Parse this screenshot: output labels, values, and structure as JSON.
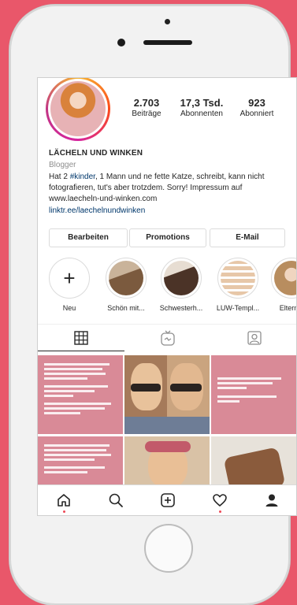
{
  "profile": {
    "name": "LÄCHELN UND WINKEN",
    "category": "Blogger",
    "bio_prefix": "Hat 2 ",
    "bio_tag": "#kinder",
    "bio_suffix": ", 1 Mann und ne fette Katze, schreibt, kann nicht fotografieren, tut's aber trotzdem. Sorry! Impressum auf www.laecheln-und-winken.com",
    "link": "linktr.ee/laechelnundwinken"
  },
  "stats": [
    {
      "value": "2.703",
      "label": "Beiträge"
    },
    {
      "value": "17,3 Tsd.",
      "label": "Abonnenten"
    },
    {
      "value": "923",
      "label": "Abonniert"
    }
  ],
  "buttons": {
    "edit": "Bearbeiten",
    "promotions": "Promotions",
    "email": "E-Mail"
  },
  "highlights": [
    {
      "label": "Neu",
      "icon": "plus-icon"
    },
    {
      "label": "Schön mit...",
      "color": "#8a6a4a"
    },
    {
      "label": "Schwesterh...",
      "color": "#6b4a3a"
    },
    {
      "label": "LUW-Templ...",
      "color": "#d9b08c"
    },
    {
      "label": "ElternO",
      "color": "#c9a27f"
    }
  ],
  "tabs": [
    {
      "name": "grid-icon"
    },
    {
      "name": "igtv-icon"
    },
    {
      "name": "tagged-icon"
    }
  ],
  "posts": [
    {
      "type": "text",
      "color": "#d98a97"
    },
    {
      "type": "photo",
      "color": "#b68b6a"
    },
    {
      "type": "text",
      "color": "#d98a97"
    },
    {
      "type": "text",
      "color": "#d98a97"
    },
    {
      "type": "photo",
      "color": "#caa07a"
    },
    {
      "type": "photo",
      "color": "#8c5b3a"
    }
  ],
  "nav": [
    {
      "name": "home-icon"
    },
    {
      "name": "search-icon"
    },
    {
      "name": "new-post-icon"
    },
    {
      "name": "heart-icon"
    },
    {
      "name": "profile-icon"
    }
  ],
  "colors": {
    "background": "#e9576a",
    "link": "#00376b",
    "post_pink": "#d98a97",
    "notification": "#ed4956"
  }
}
